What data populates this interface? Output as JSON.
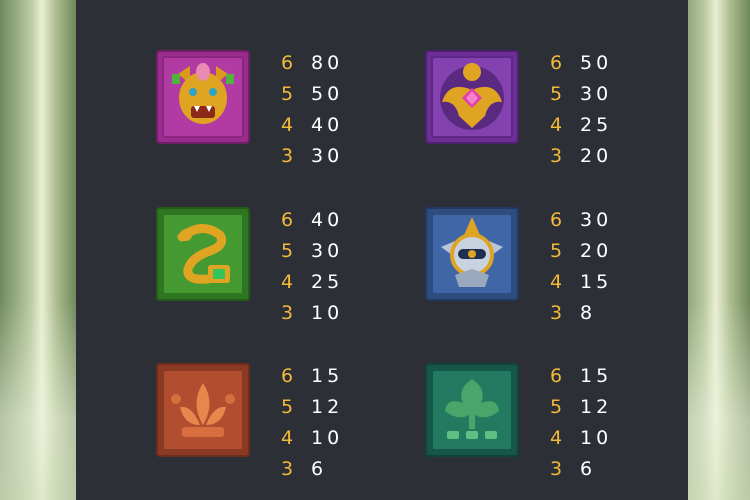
{
  "paytable": [
    {
      "symbol": "golden-jaguar-mask",
      "bg": "#a8329b",
      "rows": [
        {
          "count": "6",
          "pay": "80"
        },
        {
          "count": "5",
          "pay": "50"
        },
        {
          "count": "4",
          "pay": "40"
        },
        {
          "count": "3",
          "pay": "30"
        }
      ]
    },
    {
      "symbol": "golden-eagle-amulet",
      "bg": "#7b3aa6",
      "rows": [
        {
          "count": "6",
          "pay": "50"
        },
        {
          "count": "5",
          "pay": "30"
        },
        {
          "count": "4",
          "pay": "25"
        },
        {
          "count": "3",
          "pay": "20"
        }
      ]
    },
    {
      "symbol": "serpent-emblem",
      "bg": "#3f8b2a",
      "rows": [
        {
          "count": "6",
          "pay": "40"
        },
        {
          "count": "5",
          "pay": "30"
        },
        {
          "count": "4",
          "pay": "25"
        },
        {
          "count": "3",
          "pay": "10"
        }
      ]
    },
    {
      "symbol": "sun-mask-emblem",
      "bg": "#3c5f9a",
      "rows": [
        {
          "count": "6",
          "pay": "30"
        },
        {
          "count": "5",
          "pay": "20"
        },
        {
          "count": "4",
          "pay": "15"
        },
        {
          "count": "3",
          "pay": "8"
        }
      ]
    },
    {
      "symbol": "orange-lotus-glyph",
      "bg": "#a5452a",
      "rows": [
        {
          "count": "6",
          "pay": "15"
        },
        {
          "count": "5",
          "pay": "12"
        },
        {
          "count": "4",
          "pay": "10"
        },
        {
          "count": "3",
          "pay": "6"
        }
      ]
    },
    {
      "symbol": "green-leaf-glyph",
      "bg": "#1f6b55",
      "rows": [
        {
          "count": "6",
          "pay": "15"
        },
        {
          "count": "5",
          "pay": "12"
        },
        {
          "count": "4",
          "pay": "10"
        },
        {
          "count": "3",
          "pay": "6"
        }
      ]
    }
  ]
}
